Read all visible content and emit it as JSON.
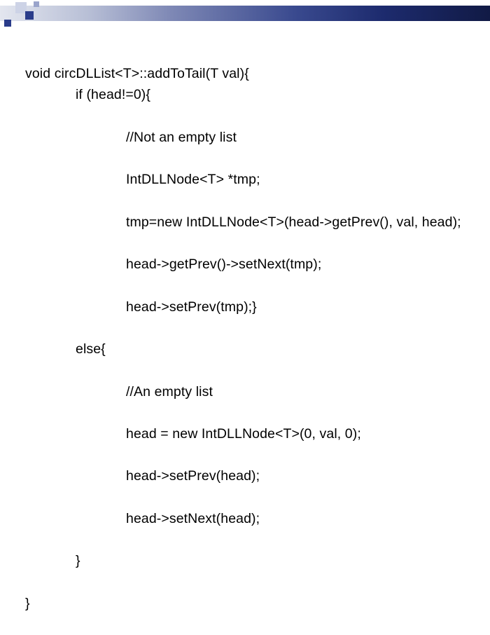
{
  "code": {
    "line1": "void circDLList<T>::addToTail(T val){",
    "line2": "if (head!=0){",
    "line3": "//Not an empty list",
    "line4": "IntDLLNode<T> *tmp;",
    "line5": "tmp=new IntDLLNode<T>(head->getPrev(), val, head);",
    "line6": "head->getPrev()->setNext(tmp);",
    "line7": "head->setPrev(tmp);}",
    "line8": "else{",
    "line9": "//An empty list",
    "line10": "head = new IntDLLNode<T>(0, val, 0);",
    "line11": "head->setPrev(head);",
    "line12": "head->setNext(head);",
    "line13": "}",
    "line14": "}"
  }
}
